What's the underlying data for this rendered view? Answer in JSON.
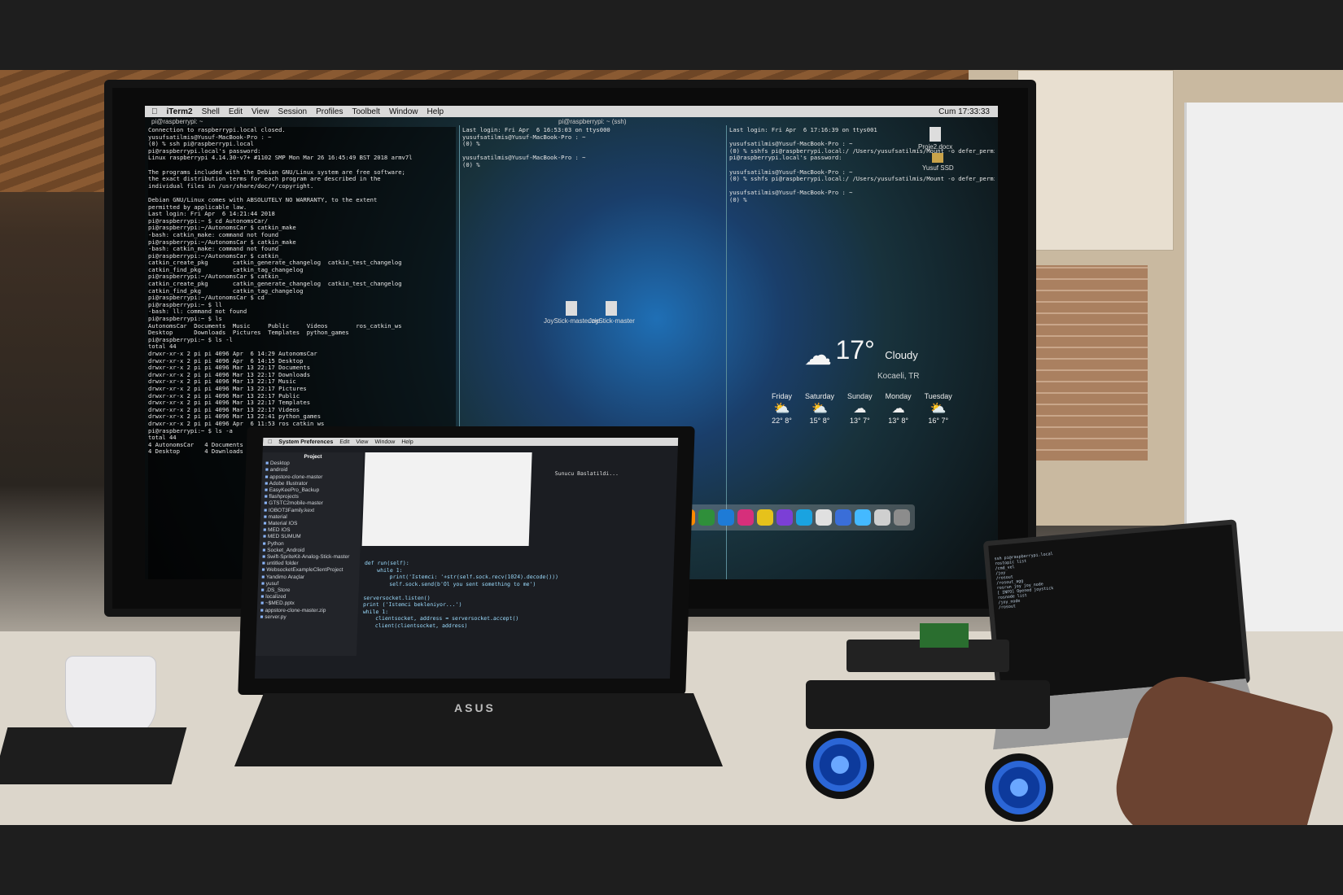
{
  "monitor": {
    "menubar": [
      "iTerm2",
      "Shell",
      "Edit",
      "View",
      "Session",
      "Profiles",
      "Toolbelt",
      "Window",
      "Help"
    ],
    "clock": "Cum 17:33:33",
    "tab_title": "pi@raspberrypi: ~",
    "tab_title_2": "pi@raspberrypi: ~ (ssh)",
    "left_terminal": "Connection to raspberrypi.local closed.\nyusufsatilmis@Yusuf-MacBook-Pro : ~\n(0) % ssh pi@raspberrypi.local\npi@raspberrypi.local's password:\nLinux raspberrypi 4.14.30-v7+ #1102 SMP Mon Mar 26 16:45:49 BST 2018 armv7l\n\nThe programs included with the Debian GNU/Linux system are free software;\nthe exact distribution terms for each program are described in the\nindividual files in /usr/share/doc/*/copyright.\n\nDebian GNU/Linux comes with ABSOLUTELY NO WARRANTY, to the extent\npermitted by applicable law.\nLast login: Fri Apr  6 14:21:44 2018\npi@raspberrypi:~ $ cd AutonomsCar/\npi@raspberrypi:~/AutonomsCar $ catkin_make\n-bash: catkin_make: command not found\npi@raspberrypi:~/AutonomsCar $ catkin_make\n-bash: catkin_make: command not found\npi@raspberrypi:~/AutonomsCar $ catkin_\ncatkin_create_pkg       catkin_generate_changelog  catkin_test_changelog\ncatkin_find_pkg         catkin_tag_changelog\npi@raspberrypi:~/AutonomsCar $ catkin_\ncatkin_create_pkg       catkin_generate_changelog  catkin_test_changelog\ncatkin_find_pkg         catkin_tag_changelog\npi@raspberrypi:~/AutonomsCar $ cd\npi@raspberrypi:~ $ ll\n-bash: ll: command not found\npi@raspberrypi:~ $ ls\nAutonomsCar  Documents  Music     Public     Videos        ros_catkin_ws\nDesktop      Downloads  Pictures  Templates  python_games\npi@raspberrypi:~ $ ls -l\ntotal 44\ndrwxr-xr-x 2 pi pi 4096 Apr  6 14:29 AutonomsCar\ndrwxr-xr-x 2 pi pi 4096 Apr  6 14:15 Desktop\ndrwxr-xr-x 2 pi pi 4096 Mar 13 22:17 Documents\ndrwxr-xr-x 2 pi pi 4096 Mar 13 22:17 Downloads\ndrwxr-xr-x 2 pi pi 4096 Mar 13 22:17 Music\ndrwxr-xr-x 2 pi pi 4096 Mar 13 22:17 Pictures\ndrwxr-xr-x 2 pi pi 4096 Mar 13 22:17 Public\ndrwxr-xr-x 2 pi pi 4096 Mar 13 22:17 Templates\ndrwxr-xr-x 2 pi pi 4096 Mar 13 22:17 Videos\ndrwxr-xr-x 2 pi pi 4096 Mar 13 22:41 python_games\ndrwxr-xr-x 2 pi pi 4096 Apr  6 11:53 ros_catkin_ws\npi@raspberrypi:~ $ ls -a\ntotal 44\n4 AutonomsCar   4 Documents  4 Public      4 Videos      4 ros_catkin_ws\n4 Desktop       4 Downloads  4 Pictures    4 Templates   4 python_games",
    "middle_terminal": "Last login: Fri Apr  6 16:53:03 on ttys000\nyusufsatilmis@Yusuf-MacBook-Pro : ~\n(0) %\n\nyusufsatilmis@Yusuf-MacBook-Pro : ~\n(0) %",
    "right_terminal": "Last login: Fri Apr  6 17:16:39 on ttys001\n\nyusufsatilmis@Yusuf-MacBook-Pro : ~\n(0) % sshfs pi@raspberrypi.local:/ /Users/yusufsatilmis/Mount -o defer_permissions\npi@raspberrypi.local's password:\n\nyusufsatilmis@Yusuf-MacBook-Pro : ~\n(0) % sshfs pi@raspberrypi.local:/ /Users/yusufsatilmis/Mount -o defer_permissions\n\nyusufsatilmis@Yusuf-MacBook-Pro : ~\n(0) %",
    "desktop_files": [
      "JoyStick-master.zip",
      "JoyStick-master",
      "Proje2.docx",
      "Yusuf SSD"
    ],
    "weather": {
      "temp": "17°",
      "condition": "Cloudy",
      "location": "Kocaeli, TR",
      "forecast": [
        {
          "day": "Friday",
          "temps": "22° 8°"
        },
        {
          "day": "Saturday",
          "temps": "15° 8°"
        },
        {
          "day": "Sunday",
          "temps": "13° 7°"
        },
        {
          "day": "Monday",
          "temps": "13° 8°"
        },
        {
          "day": "Tuesday",
          "temps": "16° 7°"
        }
      ]
    },
    "dock_colors": [
      "#ff8a00",
      "#2f8f3a",
      "#1e7bd6",
      "#d62f7b",
      "#e6c21b",
      "#7b3fd6",
      "#1aa3e0",
      "#e0e0e0",
      "#3a6ed8",
      "#44b9ff",
      "#cfcfcf",
      "#8c8c8c"
    ]
  },
  "laptop_left": {
    "brand": "ASUS",
    "menubar": [
      "System Preferences",
      "Edit",
      "View",
      "Window",
      "Help"
    ],
    "sidebar_title": "Project",
    "sidebar": [
      "Desktop",
      "android",
      "appstore-clone-master",
      "Adobe Illustrator",
      "EasyKeePro_Backup",
      "flashprojects",
      "GTSTC2mobile-master",
      "IOBOT3Family.kext",
      "material",
      "Material IOS",
      "MED IOS",
      "MED SUMUM",
      "Python",
      "Socket_Android",
      "Swift-SpriteKit-Analog-Stick-master",
      "untitled folder",
      "WebsocketExampleClientProject",
      "Yandimo Araçlar",
      "yusuf",
      ".DS_Store",
      "localized",
      "~$MED.pptx",
      "appstore-clone-master.zip",
      "server.py"
    ],
    "code": "def run(self):\n    while 1:\n        print('Istemci: '+str(self.sock.recv(1024).decode()))\n        self.sock.send(b'Ol you sent something to me')\n\nserversocket.listen()\nprint ('Istemci bekleniyor...')\nwhile 1:\n    clientsocket, address = serversocket.accept()\n    client(clientsocket, address)",
    "status": "Sunucu Baslatildi..."
  },
  "laptop_right": {
    "terminal": "ssh pi@raspberrypi.local\nrostopic list\n/cmd_vel\n/joy\n/rosout\n/rosout_agg\nrosrun joy joy_node\n[ INFO] Opened joystick\nrosnode list\n/joy_node\n/rosout"
  }
}
